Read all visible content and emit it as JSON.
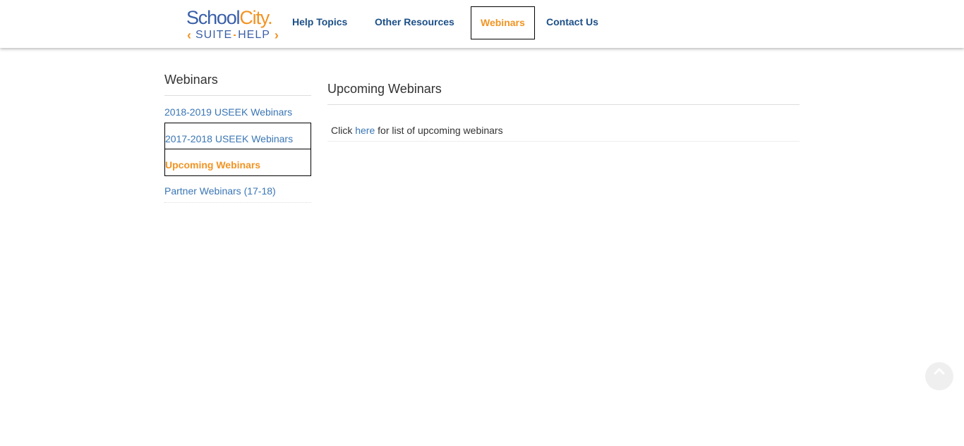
{
  "logo": {
    "top_part1": "School",
    "top_part2": "City",
    "top_part2_suffix": ".",
    "left_chevron": "‹",
    "suite": "SUITE",
    "help": "HELP",
    "right_chevron": "›"
  },
  "nav": {
    "items": [
      {
        "label": "Help Topics",
        "active": false
      },
      {
        "label": "Other Resources",
        "active": false
      },
      {
        "label": "Webinars",
        "active": true
      },
      {
        "label": "Contact Us",
        "active": false
      }
    ]
  },
  "sidebar": {
    "title": "Webinars",
    "items": [
      {
        "label": "2018-2019 USEEK Webinars",
        "active": false
      },
      {
        "label": "2017-2018 USEEK Webinars",
        "active": false
      },
      {
        "label": "Upcoming Webinars",
        "active": true
      },
      {
        "label": "Partner Webinars (17-18)",
        "active": false
      }
    ]
  },
  "main": {
    "title": "Upcoming Webinars",
    "row": {
      "prefix": "Click",
      "link": "here",
      "suffix": "for list of upcoming webinars"
    }
  },
  "scroll_top": {
    "icon": "chevron-up-icon"
  },
  "colors": {
    "brand_blue": "#3a5fa8",
    "brand_orange": "#f29423",
    "nav_text": "#1c4f87",
    "link": "#3a76b5",
    "heading": "#333333"
  }
}
